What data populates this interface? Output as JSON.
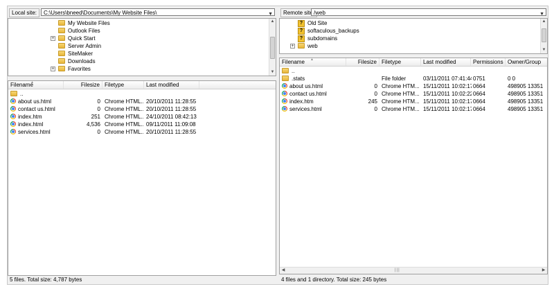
{
  "local": {
    "site_label": "Local site:",
    "site_path": "C:\\Users\\bneed\\Documents\\My Website Files\\",
    "tree": [
      {
        "label": "My Website Files",
        "expander": ""
      },
      {
        "label": "Outlook Files",
        "expander": ""
      },
      {
        "label": "Quick Start",
        "expander": "+"
      },
      {
        "label": "Server Admin",
        "expander": ""
      },
      {
        "label": "SiteMaker",
        "expander": ""
      },
      {
        "label": "Downloads",
        "expander": ""
      },
      {
        "label": "Favorites",
        "expander": "+"
      }
    ],
    "columns": {
      "filename": "Filename",
      "filesize": "Filesize",
      "filetype": "Filetype",
      "modified": "Last modified"
    },
    "files": [
      {
        "name": "..",
        "size": "",
        "type": "",
        "modified": "",
        "icon": "folder-icon"
      },
      {
        "name": "about us.html",
        "size": "0",
        "type": "Chrome HTML...",
        "modified": "20/10/2011 11:28:55",
        "icon": "chrome-icon"
      },
      {
        "name": "contact us.html",
        "size": "0",
        "type": "Chrome HTML...",
        "modified": "20/10/2011 11:28:55",
        "icon": "chrome-icon"
      },
      {
        "name": "index.htm",
        "size": "251",
        "type": "Chrome HTML...",
        "modified": "24/10/2011 08:42:13",
        "icon": "chrome-icon"
      },
      {
        "name": "index.html",
        "size": "4,536",
        "type": "Chrome HTML...",
        "modified": "09/11/2011 11:09:08",
        "icon": "chrome-icon"
      },
      {
        "name": "services.html",
        "size": "0",
        "type": "Chrome HTML...",
        "modified": "20/10/2011 11:28:55",
        "icon": "chrome-icon"
      }
    ],
    "status": "5 files. Total size: 4,787 bytes"
  },
  "remote": {
    "site_label": "Remote site:",
    "site_path": "/web",
    "tree": [
      {
        "label": "Old Site",
        "expander": ""
      },
      {
        "label": "softaculous_backups",
        "expander": ""
      },
      {
        "label": "subdomains",
        "expander": ""
      },
      {
        "label": "web",
        "expander": "+"
      }
    ],
    "columns": {
      "filename": "Filename",
      "filesize": "Filesize",
      "filetype": "Filetype",
      "modified": "Last modified",
      "permissions": "Permissions",
      "owner": "Owner/Group"
    },
    "files": [
      {
        "name": "..",
        "size": "",
        "type": "",
        "modified": "",
        "perms": "",
        "owner": "",
        "icon": "folder-icon"
      },
      {
        "name": ".stats",
        "size": "",
        "type": "File folder",
        "modified": "03/11/2011 07:41:44",
        "perms": "0751",
        "owner": "0 0",
        "icon": "folder-icon"
      },
      {
        "name": "about us.html",
        "size": "0",
        "type": "Chrome HTM...",
        "modified": "15/11/2011 10:02:17",
        "perms": "0664",
        "owner": "498905 13351",
        "icon": "chrome-icon"
      },
      {
        "name": "contact us.html",
        "size": "0",
        "type": "Chrome HTM...",
        "modified": "15/11/2011 10:02:22",
        "perms": "0664",
        "owner": "498905 13351",
        "icon": "chrome-icon"
      },
      {
        "name": "index.htm",
        "size": "245",
        "type": "Chrome HTM...",
        "modified": "15/11/2011 10:02:17",
        "perms": "0664",
        "owner": "498905 13351",
        "icon": "chrome-icon"
      },
      {
        "name": "services.html",
        "size": "0",
        "type": "Chrome HTM...",
        "modified": "15/11/2011 10:02:17",
        "perms": "0664",
        "owner": "498905 13351",
        "icon": "chrome-icon"
      }
    ],
    "status": "4 files and 1 directory. Total size: 245 bytes"
  }
}
